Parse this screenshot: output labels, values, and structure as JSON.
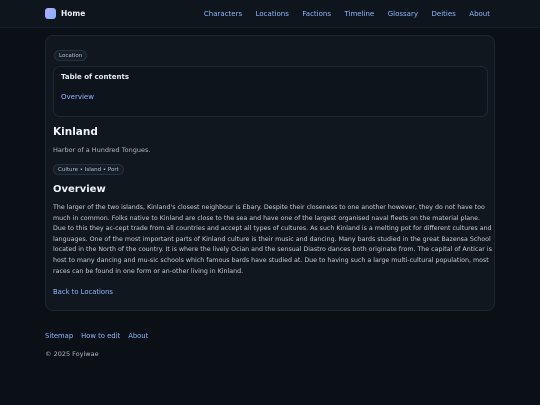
{
  "header": {
    "brand": "Home",
    "nav": [
      "Characters",
      "Locations",
      "Factions",
      "Timeline",
      "Glossary",
      "Deities",
      "About"
    ]
  },
  "article": {
    "category": "Location",
    "toc": {
      "title": "Table of contents",
      "items": [
        "Overview"
      ]
    },
    "title": "Kinland",
    "tagline": "Harbor of a Hundred Tongues.",
    "tags": "Culture • Island • Port",
    "section_title": "Overview",
    "body": "The larger of the two islands, Kinland's closest neighbour is Ebary. Despite their closeness to one another however, they do not have too much in common. Folks native to Kinland are close to the sea and have one of the largest organised naval fleets on the material plane. Due to this they ac-cept trade from all countries and accept all types of cultures. As such Kinland is a melting pot for different cultures and languages. One of the most important parts of Kinland culture is their music and dancing. Many bards studied in the great Bazensa School located in the North of the country. It is where the lively Ocian and the sensual Diastro dances both originate from. The capital of Anticar is host to many dancing and mu-sic schools which famous bards have studied at. Due to having such a large multi-cultural population, most races can be found in one form or an-other living in Kinland.",
    "back_link": "Back to Locations"
  },
  "footer": {
    "links": [
      "Sitemap",
      "How to edit",
      "About"
    ],
    "copyright": "© 2025 Foyiwae"
  },
  "colors": {
    "background": "#0b1016",
    "card": "#10171f",
    "link": "#8fb8ff",
    "heading": "#eef3f8"
  }
}
